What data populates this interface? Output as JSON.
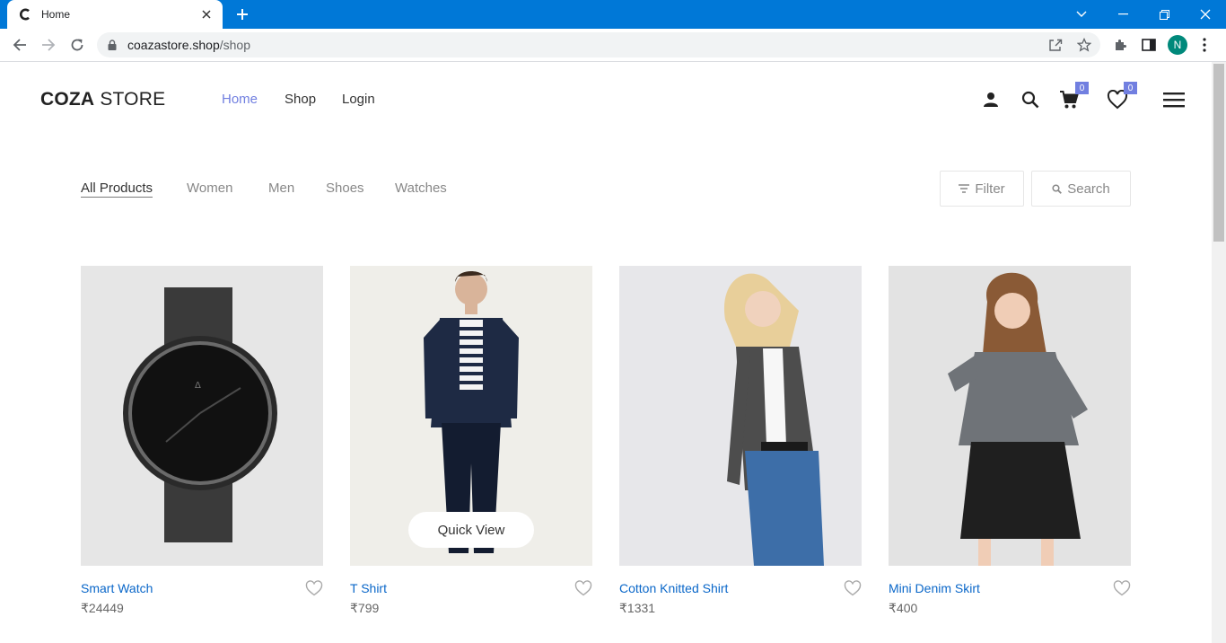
{
  "browser": {
    "tab_title": "Home",
    "url_host": "coazastore.shop",
    "url_path": "/shop",
    "profile_initial": "N"
  },
  "header": {
    "logo_bold": "COZA",
    "logo_light": " STORE",
    "nav": [
      "Home",
      "Shop",
      "Login"
    ],
    "cart_count": "0",
    "wishlist_count": "0"
  },
  "filters": {
    "categories": [
      "All Products",
      "Women",
      "Men",
      "Shoes",
      "Watches"
    ],
    "filter_label": "Filter",
    "search_label": "Search"
  },
  "products": [
    {
      "name": "Smart Watch",
      "price": "₹24449"
    },
    {
      "name": "T Shirt",
      "price": "₹799",
      "quick_view": "Quick View"
    },
    {
      "name": "Cotton Knitted Shirt",
      "price": "₹1331"
    },
    {
      "name": "Mini Denim Skirt",
      "price": "₹400"
    }
  ],
  "colors": {
    "accent": "#717fe0",
    "browser_bar": "#0078d7",
    "product_link": "#0a67c9"
  }
}
